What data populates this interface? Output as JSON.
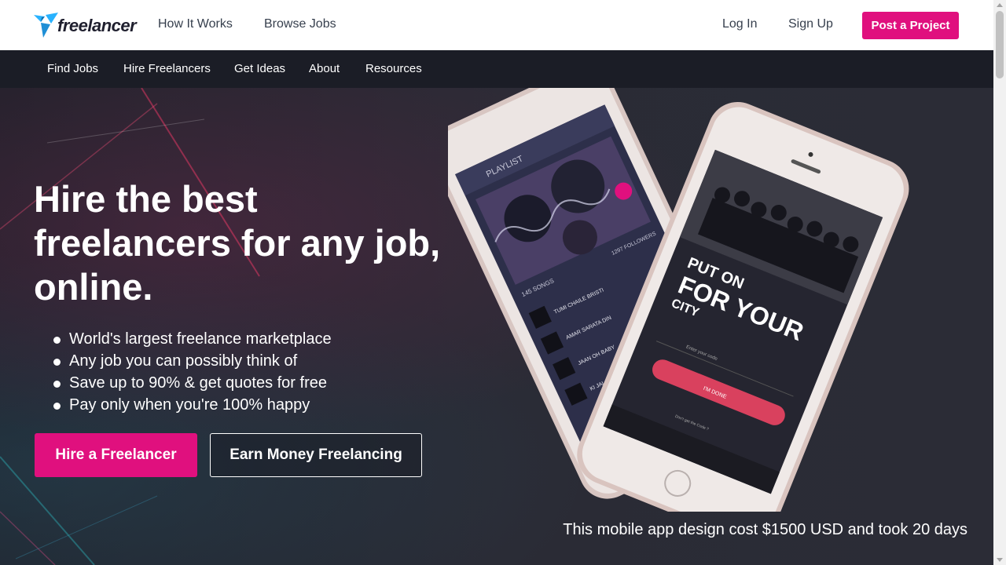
{
  "header": {
    "logo_text": "freelancer",
    "nav": [
      {
        "label": "How It Works"
      },
      {
        "label": "Browse Jobs"
      }
    ],
    "login_label": "Log In",
    "signup_label": "Sign Up",
    "post_project_label": "Post a Project"
  },
  "subnav": {
    "items": [
      {
        "label": "Find Jobs"
      },
      {
        "label": "Hire Freelancers"
      },
      {
        "label": "Get Ideas"
      },
      {
        "label": "About"
      },
      {
        "label": "Resources"
      }
    ]
  },
  "hero": {
    "title": "Hire the best freelancers for any job, online.",
    "bullets": [
      "World's largest freelance marketplace",
      "Any job you can possibly think of",
      "Save up to 90% & get quotes for free",
      "Pay only when you're 100% happy"
    ],
    "hire_button": "Hire a Freelancer",
    "earn_button": "Earn Money Freelancing",
    "caption": "This mobile app design cost $1500 USD and took 20 days"
  },
  "phone_screens": {
    "left": {
      "header": "PLAYLIST",
      "songs_count": "145 SONGS",
      "followers_count": "1297 FOLLOWERS",
      "tracks": [
        "TUMI CHAILE BRISTI",
        "AMAR SARATA DIN",
        "JAAN OH BABY",
        "KI JALA DIE GELA"
      ]
    },
    "right": {
      "headline_1": "PUT ON",
      "headline_2": "FOR YOUR",
      "headline_3": "CITY",
      "input_placeholder": "Enter your code",
      "button_label": "I'M DONE",
      "footer_text": "Don't get the Code ?"
    }
  },
  "colors": {
    "accent": "#e0107e",
    "subnav_bg": "#1b1d26",
    "header_bg": "#ffffff",
    "logo_blue": "#29b2fe"
  },
  "icons": {
    "logo": "freelancer-bird-logo-icon"
  }
}
